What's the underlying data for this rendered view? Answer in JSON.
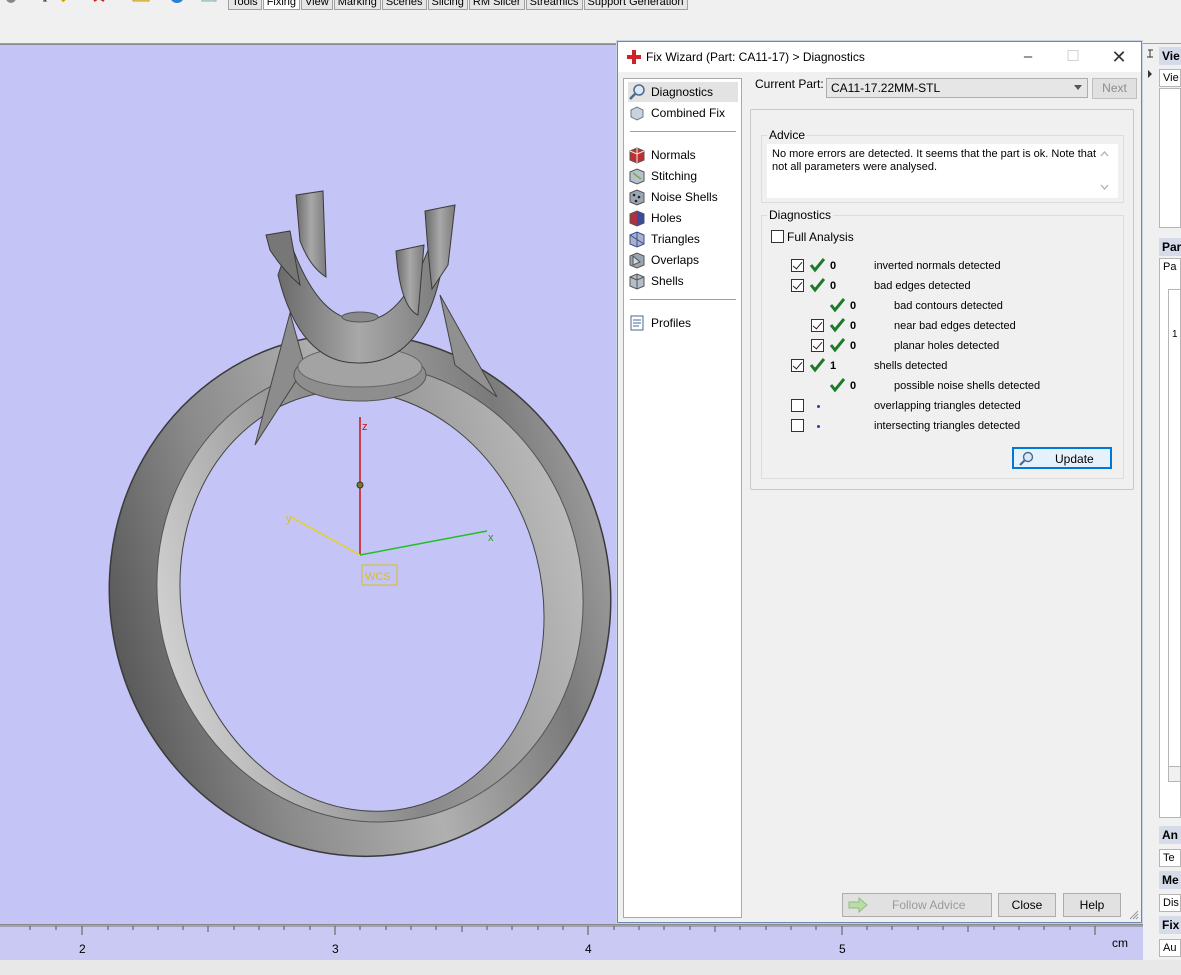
{
  "ribbon": {
    "tabs": [
      "Tools",
      "Fixing",
      "View",
      "Marking",
      "Scenes",
      "Slicing",
      "RM Slicer",
      "Streamics",
      "Support Generation"
    ],
    "active_tab": "Fixing"
  },
  "viewport": {
    "axis_z": "z",
    "axis_y": "y",
    "axis_x": "x",
    "wcs_label": "WCS",
    "background": "#c4c4f6"
  },
  "ruler": {
    "ticks": [
      "2",
      "3",
      "4",
      "5"
    ],
    "unit": "cm"
  },
  "wizard": {
    "title": "Fix Wizard (Part: CA11-17) > Diagnostics",
    "nav": {
      "top": [
        "Diagnostics",
        "Combined Fix"
      ],
      "tools": [
        "Normals",
        "Stitching",
        "Noise Shells",
        "Holes",
        "Triangles",
        "Overlaps",
        "Shells"
      ],
      "bottom": [
        "Profiles"
      ],
      "active": "Diagnostics"
    },
    "current_part_label": "Current Part:",
    "current_part_value": "CA11-17.22MM-STL",
    "next_label": "Next",
    "advice": {
      "title": "Advice",
      "text": "No more errors are detected. It seems that the part is ok. Note that not all parameters were analysed."
    },
    "diagnostics": {
      "title": "Diagnostics",
      "full_analysis_label": "Full Analysis",
      "rows": [
        {
          "count": "0",
          "label": "inverted normals detected"
        },
        {
          "count": "0",
          "label": "bad edges detected"
        },
        {
          "count": "0",
          "label": "bad contours detected"
        },
        {
          "count": "0",
          "label": "near bad edges detected"
        },
        {
          "count": "0",
          "label": "planar holes detected"
        },
        {
          "count": "1",
          "label": "shells detected"
        },
        {
          "count": "0",
          "label": "possible noise shells detected"
        },
        {
          "count": "",
          "label": "overlapping triangles detected"
        },
        {
          "count": "",
          "label": "intersecting triangles detected"
        }
      ]
    },
    "update_label": "Update",
    "follow_advice_label": "Follow Advice",
    "close_label": "Close",
    "help_label": "Help"
  },
  "right_panel": {
    "headers": [
      "Vie",
      "Par",
      "An",
      "Me",
      "Fix"
    ],
    "fields": [
      "Vie",
      "Pa",
      "Te",
      "Dis",
      "Au"
    ],
    "list_value": "1"
  },
  "colors": {
    "accent": "#0078d7",
    "check_green": "#1d7a2a",
    "dot_blue": "#1e3fbf"
  }
}
